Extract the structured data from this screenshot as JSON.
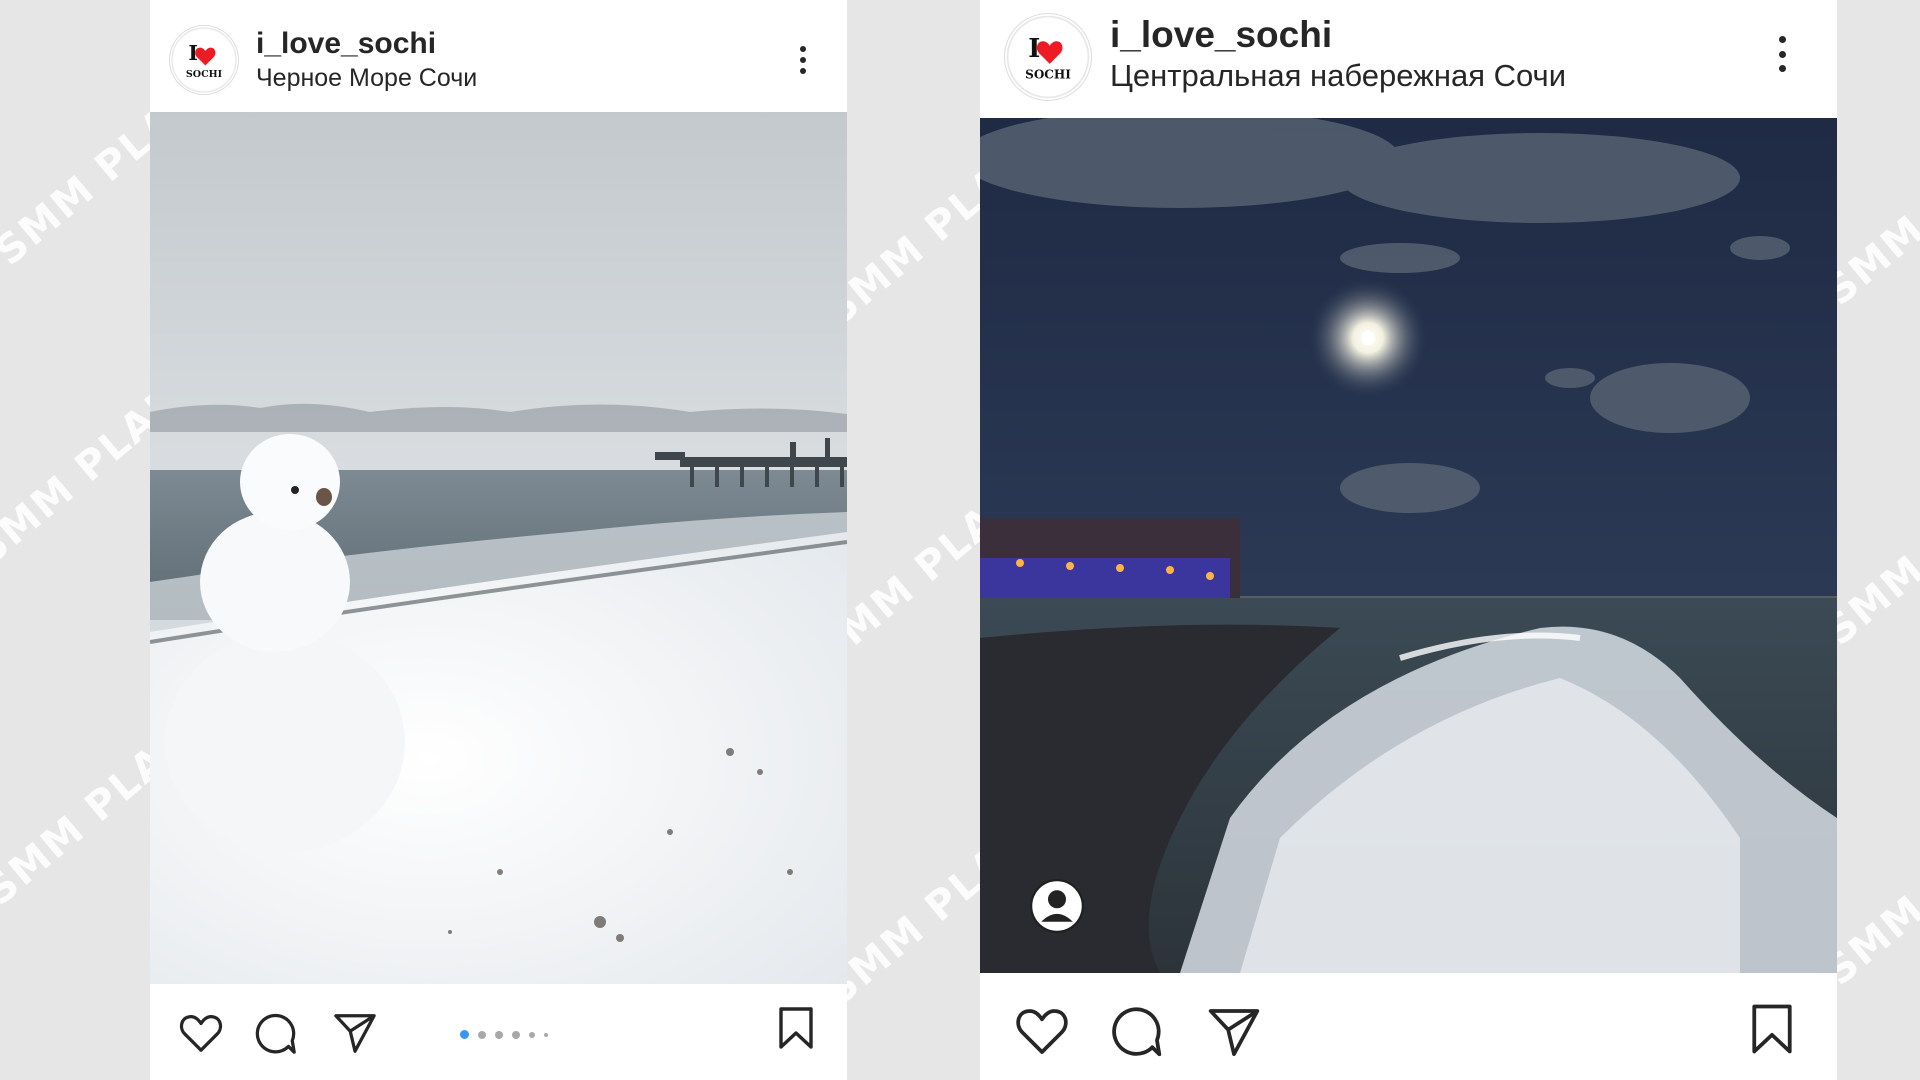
{
  "posts": [
    {
      "username": "i_love_sochi",
      "location": "Черное Море Сочи",
      "avatar_text": {
        "top": "I",
        "bottom": "SOCHI"
      },
      "photo_subject": "snowman on a snowy beach by the sea with a pier",
      "carousel_dots": 6,
      "carousel_active": 0
    },
    {
      "username": "i_love_sochi",
      "location": "Центральная набережная Сочи",
      "avatar_text": {
        "top": "I",
        "bottom": "SOCHI"
      },
      "photo_subject": "night beach under the moon with waves and lit promenade",
      "has_tag_badge": true
    }
  ],
  "watermark_text": "SMM PLANNER",
  "colors": {
    "background": "#e6e6e6",
    "text": "#262626",
    "accent_dot": "#3897f0",
    "heart_red": "#ed1c24"
  },
  "icons": [
    "heart-icon",
    "comment-icon",
    "share-icon",
    "bookmark-icon",
    "more-icon",
    "user-tag-icon"
  ]
}
